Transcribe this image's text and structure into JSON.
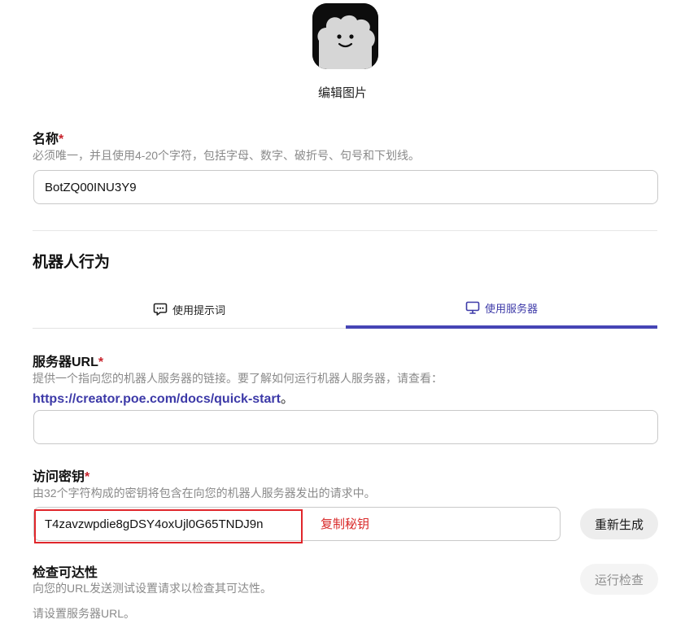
{
  "edit_photo_label": "编辑图片",
  "name_field": {
    "label": "名称",
    "required_mark": "*",
    "hint": "必须唯一，并且使用4-20个字符，包括字母、数字、破折号、句号和下划线。",
    "value": "BotZQ00INU3Y9"
  },
  "bot_behavior": {
    "title": "机器人行为",
    "tabs": [
      {
        "label": "使用提示词",
        "icon": "chat-bubble-icon",
        "active": false
      },
      {
        "label": "使用服务器",
        "icon": "monitor-icon",
        "active": true
      }
    ]
  },
  "server_url": {
    "label": "服务器URL",
    "required_mark": "*",
    "hint": "提供一个指向您的机器人服务器的链接。要了解如何运行机器人服务器，请查看：",
    "link_text": "https://creator.poe.com/docs/quick-start",
    "link_suffix": "。",
    "value": ""
  },
  "access_key": {
    "label": "访问密钥",
    "required_mark": "*",
    "hint": "由32个字符构成的密钥将包含在向您的机器人服务器发出的请求中。",
    "value": "T4zavzwpdie8gDSY4oxUjl0G65TNDJ9n",
    "copy_label": "复制秘钥",
    "regenerate_label": "重新生成"
  },
  "reachability": {
    "label": "检查可达性",
    "hint": "向您的URL发送测试设置请求以检查其可达性。",
    "run_label": "运行检查",
    "status": "请设置服务器URL。"
  },
  "colors": {
    "accent": "#4645b5",
    "required": "#c8232c",
    "highlight_border": "#e0262b",
    "copy_text": "#d92a2a"
  }
}
